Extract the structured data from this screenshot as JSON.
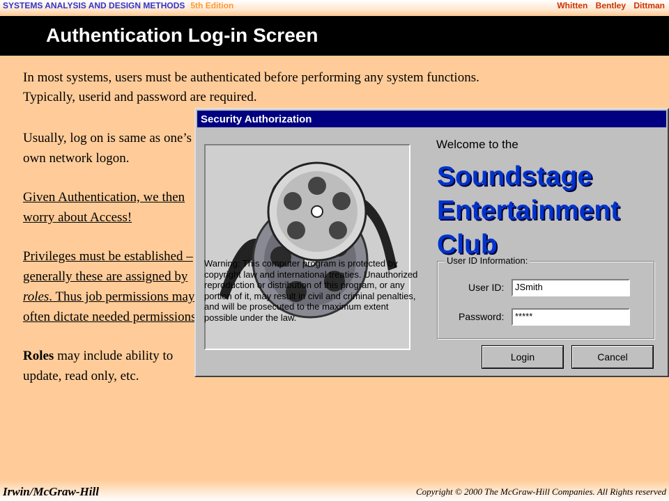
{
  "header": {
    "book_title": "SYSTEMS ANALYSIS AND DESIGN METHODS",
    "edition": "5th Edition",
    "authors": "Whitten Bentley Dittman"
  },
  "slide": {
    "title": "Authentication Log-in Screen",
    "intro_line1": "In most systems, users must be authenticated before performing any system functions.",
    "intro_line2": "Typically, userid and password are required.",
    "para1": "Usually, log on is same as one’s own network logon.",
    "para2": "Given Authentication, we then worry about Access!",
    "para3_a": "Privileges must be established – generally these are assigned by ",
    "para3_roles": "roles",
    "para3_b": ".  Thus job permissions may often dictate needed permissions.",
    "para4_bold": "Roles",
    "para4_rest": " may include ability to update, read only, etc."
  },
  "dialog": {
    "title": "Security Authorization",
    "welcome": "Welcome to the",
    "brand_line1": "Soundstage",
    "brand_line2": "Entertainment",
    "brand_line3": "Club",
    "warning": "Warning: This computer program is protected by copyright law and international treaties. Unauthorized reproduction or distribution of this program, or any portion of it, may result in civil and criminal penalties, and will be prosecuted to the maximum extent possible under the law.",
    "group_label": "User ID Information:",
    "userid_label": "User ID:",
    "userid_value": "JSmith",
    "password_label": "Password:",
    "password_value": "*****",
    "login_button": "Login",
    "cancel_button": "Cancel",
    "image_icon": "film-reel-icon"
  },
  "footer": {
    "publisher": "Irwin/McGraw-Hill",
    "copyright": "Copyright © 2000 The McGraw-Hill Companies. All Rights reserved"
  },
  "colors": {
    "background": "#ffcc99",
    "title_bar": "#000000",
    "dialog_title": "#000080",
    "brand": "#0033cc"
  }
}
